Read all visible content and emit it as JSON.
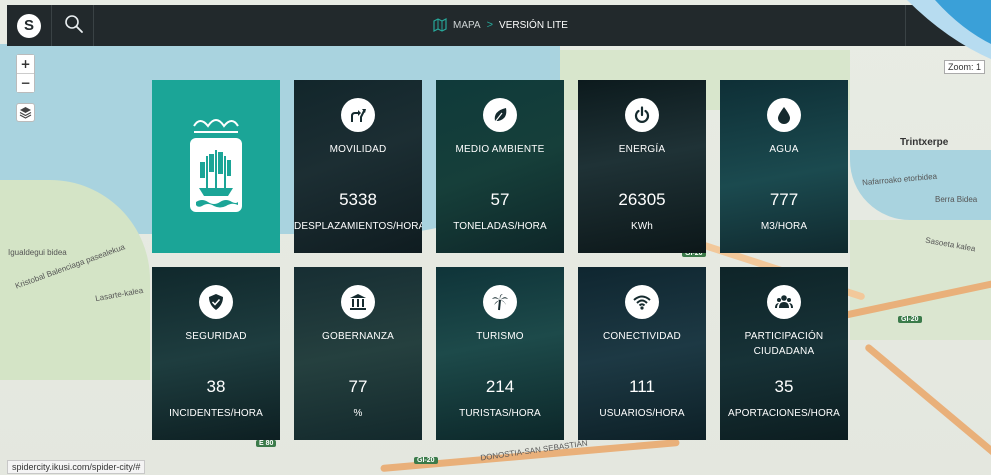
{
  "header": {
    "logo_letter": "S",
    "breadcrumb": {
      "map_label": "MAPA",
      "separator": ">",
      "current": "VERSIÓN LITE"
    }
  },
  "map": {
    "zoom_label": "Zoom: 1",
    "zoom_in": "+",
    "zoom_out": "−",
    "labels": [
      "Trintxerpe",
      "Nafarroako etorbidea",
      "Berra Bidea",
      "Sasoeta kalea",
      "Kristobal Balenciaga pasealekua",
      "Lasarte-kalea",
      "Igualdegui bidea",
      "GI-20",
      "GI-20",
      "E 80",
      "GI-20",
      "DONOSTIA-SAN SEBASTIÁN"
    ]
  },
  "tiles": [
    {
      "title": "MOVILIDAD",
      "value": "5338",
      "unit": "DESPLAZAMIENTOS/HORA",
      "icon": "directions-icon"
    },
    {
      "title": "MEDIO AMBIENTE",
      "value": "57",
      "unit": "TONELADAS/HORA",
      "icon": "leaf-icon"
    },
    {
      "title": "ENERGÍA",
      "value": "26305",
      "unit": "KWh",
      "icon": "power-icon"
    },
    {
      "title": "AGUA",
      "value": "777",
      "unit": "M3/HORA",
      "icon": "water-drop-icon"
    },
    {
      "title": "SEGURIDAD",
      "value": "38",
      "unit": "INCIDENTES/HORA",
      "icon": "shield-icon"
    },
    {
      "title": "GOBERNANZA",
      "value": "77",
      "unit": "%",
      "icon": "institution-icon"
    },
    {
      "title": "TURISMO",
      "value": "214",
      "unit": "TURISTAS/HORA",
      "icon": "palm-tree-icon"
    },
    {
      "title": "CONECTIVIDAD",
      "value": "111",
      "unit": "USUARIOS/HORA",
      "icon": "wifi-icon"
    },
    {
      "title": "PARTICIPACIÓN CIUDADANA",
      "value": "35",
      "unit": "APORTACIONES/HORA",
      "icon": "people-icon"
    }
  ],
  "status_url": "spidercity.ikusi.com/spider-city/#",
  "colors": {
    "accent": "#1ba597",
    "topbar": "#22292c"
  }
}
